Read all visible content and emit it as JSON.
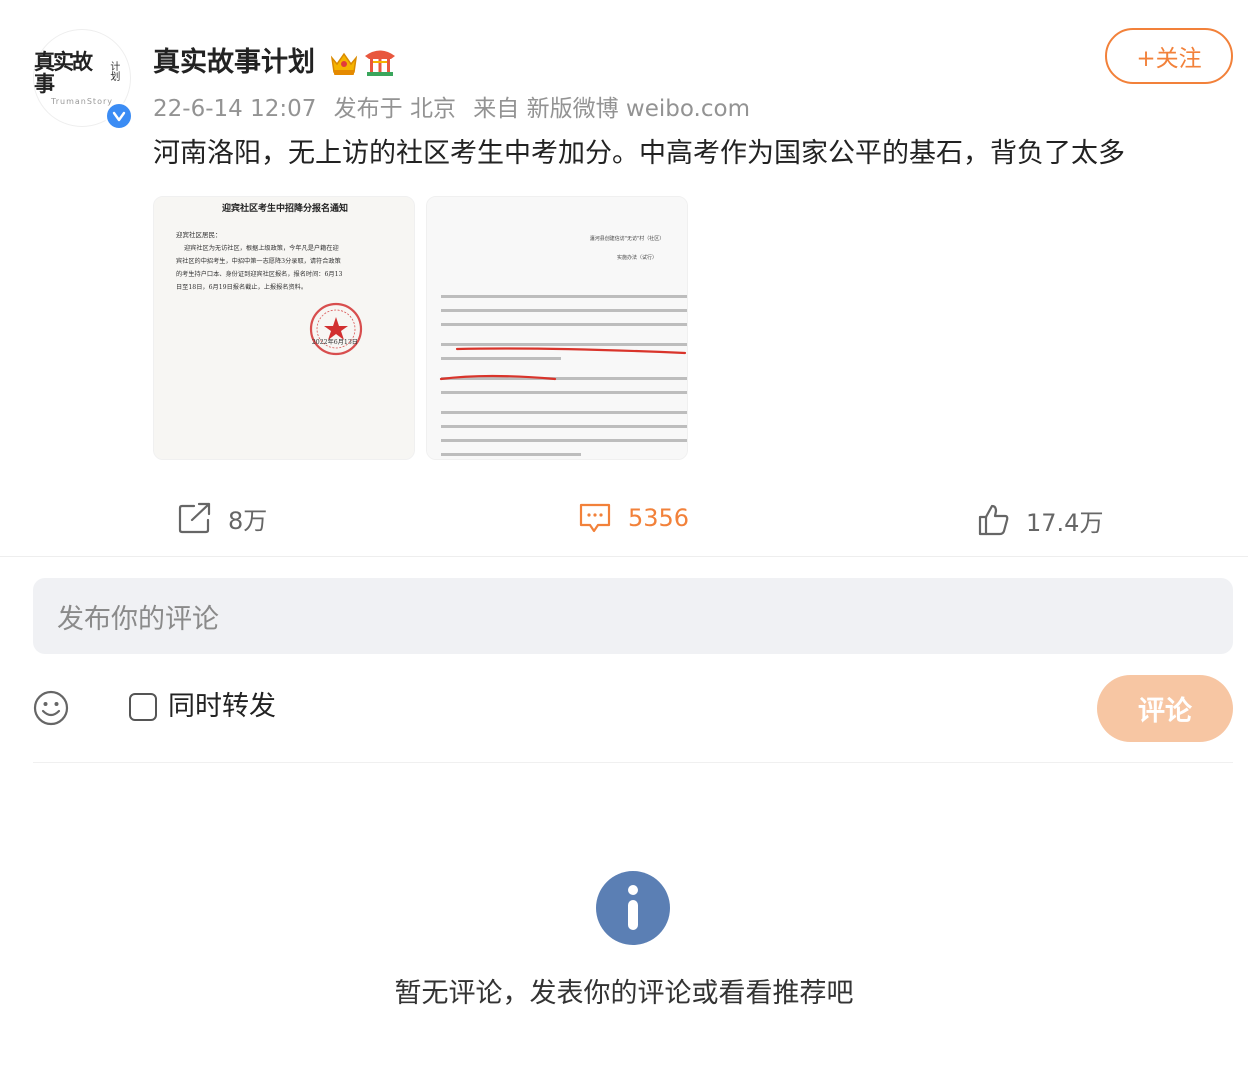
{
  "post": {
    "author": {
      "name": "真实故事计划",
      "avatar_text_main": "真实故事",
      "avatar_text_side": "计划",
      "avatar_subtext": "TrumanStory",
      "verified": true,
      "badges": [
        "crown-badge-icon",
        "pavilion-badge-icon"
      ]
    },
    "meta": {
      "time": "22-6-14 12:07",
      "location": "发布于 北京",
      "source": "来自 新版微博 weibo.com"
    },
    "follow_label": "+关注",
    "text": "河南洛阳，无上访的社区考生中考加分。中高考作为国家公平的基石，背负了太多",
    "images": [
      {
        "title": "迎宾社区考生中招降分报名通知",
        "greeting": "迎宾社区居民：",
        "body_lines": [
          "迎宾社区为无访社区，根据上级政策，今年凡是户籍在迎",
          "宾社区的中招考生，中招中第一志愿降3分录取，请符合政策",
          "的考生持户口本、身份证到迎宾社区报名，报名时间：6月13",
          "日至18日，6月19日报名截止，上报报名资料。"
        ],
        "date": "2022年6月13日"
      },
      {
        "title": "瀍河县创建信访\"无访\"村（社区）",
        "subtitle": "实施办法（试行）"
      }
    ]
  },
  "actions": {
    "repost_count": "8万",
    "comment_count": "5356",
    "like_count": "17.4万"
  },
  "comment_form": {
    "placeholder": "发布你的评论",
    "repost_label": "同时转发",
    "submit_label": "评论"
  },
  "empty_state": {
    "message": "暂无评论，发表你的评论或看看推荐吧"
  },
  "colors": {
    "accent": "#f2813a",
    "submit_disabled": "#f7c6a3",
    "verified": "#3b8cf4",
    "info": "#5b7fb4"
  }
}
